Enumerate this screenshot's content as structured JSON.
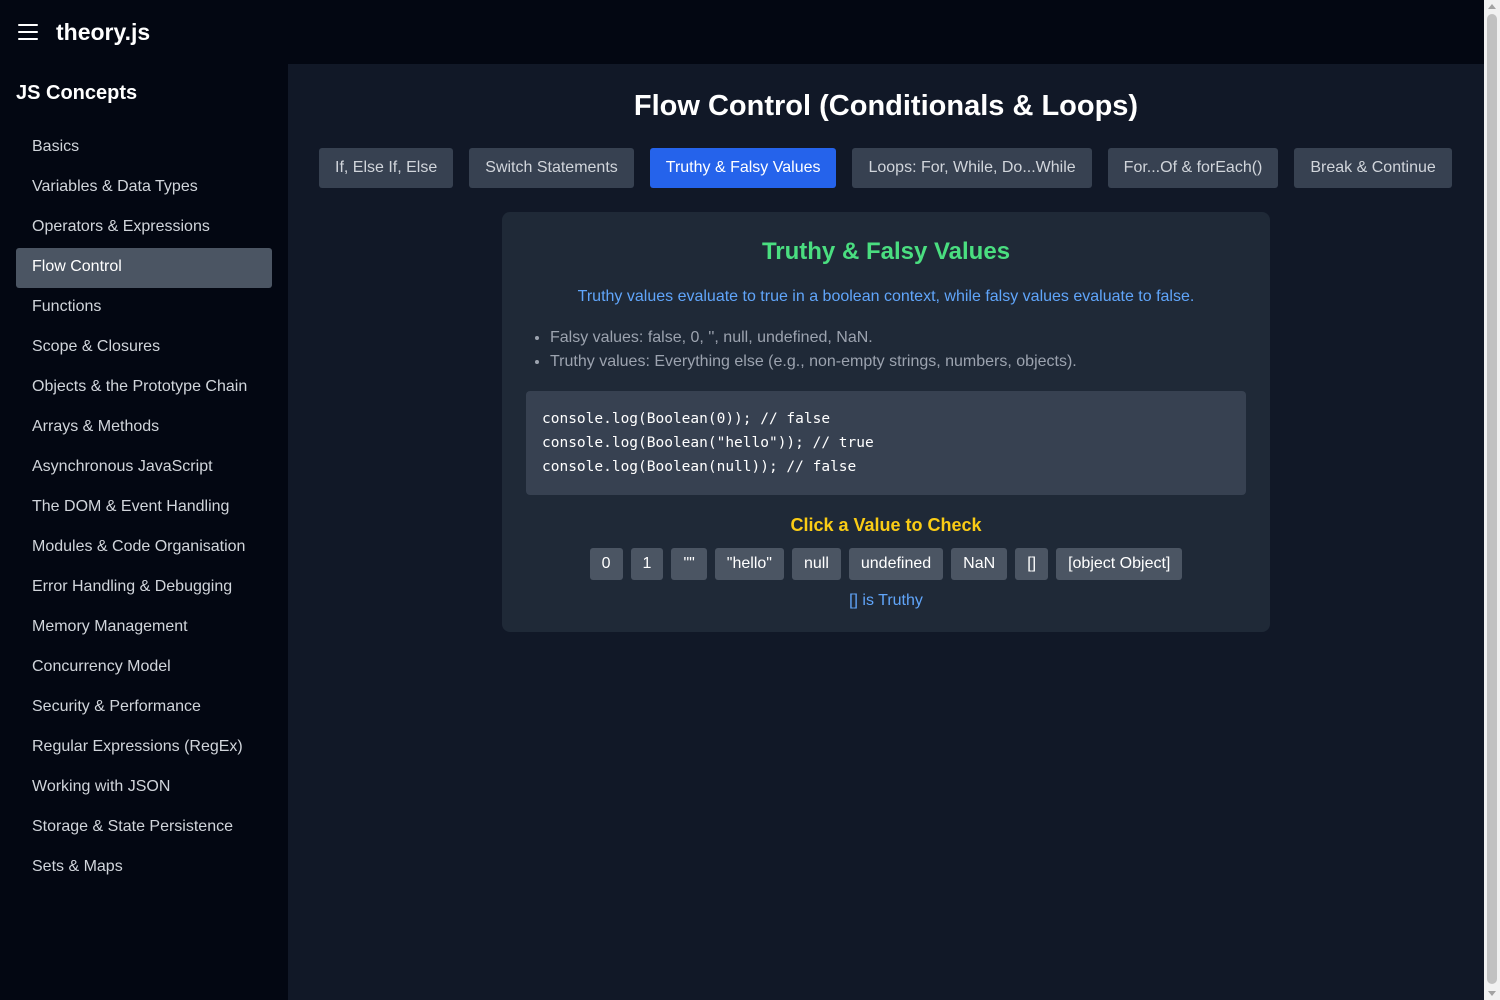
{
  "app": {
    "brand": "theory.js"
  },
  "sidebar": {
    "title": "JS Concepts",
    "items": [
      {
        "label": "Basics"
      },
      {
        "label": "Variables & Data Types"
      },
      {
        "label": "Operators & Expressions"
      },
      {
        "label": "Flow Control",
        "active": true
      },
      {
        "label": "Functions"
      },
      {
        "label": "Scope & Closures"
      },
      {
        "label": "Objects & the Prototype Chain"
      },
      {
        "label": "Arrays & Methods"
      },
      {
        "label": "Asynchronous JavaScript"
      },
      {
        "label": "The DOM & Event Handling"
      },
      {
        "label": "Modules & Code Organisation"
      },
      {
        "label": "Error Handling & Debugging"
      },
      {
        "label": "Memory Management"
      },
      {
        "label": "Concurrency Model"
      },
      {
        "label": "Security & Performance"
      },
      {
        "label": "Regular Expressions (RegEx)"
      },
      {
        "label": "Working with JSON"
      },
      {
        "label": "Storage & State Persistence"
      },
      {
        "label": "Sets & Maps"
      }
    ]
  },
  "main": {
    "title": "Flow Control (Conditionals & Loops)",
    "tabs": [
      {
        "label": "If, Else If, Else"
      },
      {
        "label": "Switch Statements"
      },
      {
        "label": "Truthy & Falsy Values",
        "active": true
      },
      {
        "label": "Loops: For, While, Do...While"
      },
      {
        "label": "For...Of & forEach()"
      },
      {
        "label": "Break & Continue"
      }
    ],
    "card": {
      "title": "Truthy & Falsy Values",
      "description": "Truthy values evaluate to true in a boolean context, while falsy values evaluate to false.",
      "bullets": [
        "Falsy values: false, 0, '', null, undefined, NaN.",
        "Truthy values: Everything else (e.g., non-empty strings, numbers, objects)."
      ],
      "code": [
        "console.log(Boolean(0)); // false",
        "console.log(Boolean(\"hello\")); // true",
        "console.log(Boolean(null)); // false"
      ],
      "check_title": "Click a Value to Check",
      "values": [
        "0",
        "1",
        "\"\"",
        "\"hello\"",
        "null",
        "undefined",
        "NaN",
        "[]",
        "[object Object]"
      ],
      "result": "[] is Truthy"
    }
  },
  "colors": {
    "accent": "#2563eb",
    "card_title": "#4ade80",
    "info_text": "#60a5fa",
    "check_title": "#facc15"
  }
}
